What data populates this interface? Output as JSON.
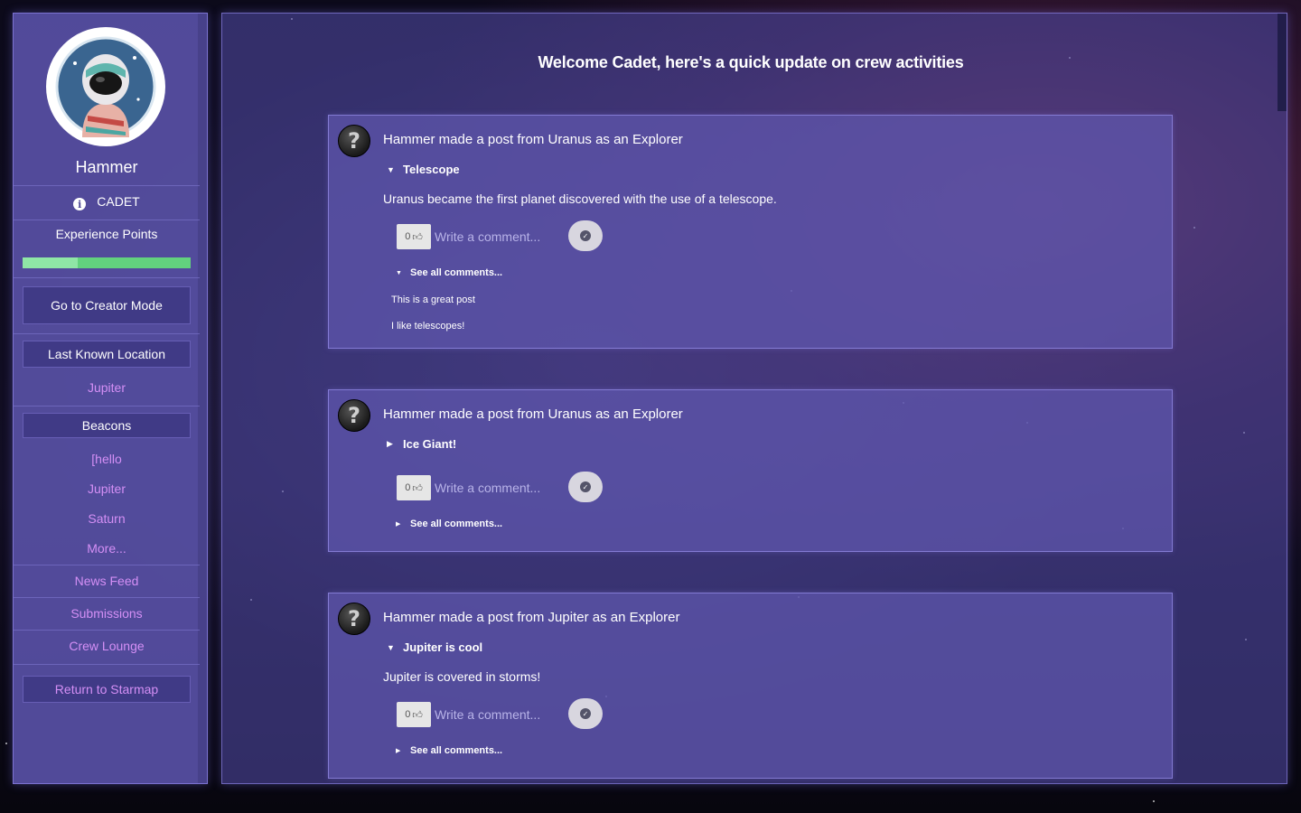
{
  "sidebar": {
    "username": "Hammer",
    "rank": "CADET",
    "xp_label": "Experience Points",
    "xp_progress": 0.33,
    "creator_mode_label": "Go to Creator Mode",
    "last_location_label": "Last Known Location",
    "last_location_value": "Jupiter",
    "beacons_label": "Beacons",
    "beacons": [
      "[hello",
      "Jupiter",
      "Saturn",
      "More..."
    ],
    "nav": [
      "News Feed",
      "Submissions",
      "Crew Lounge"
    ],
    "return_label": "Return to Starmap"
  },
  "main": {
    "welcome": "Welcome Cadet, here's a quick update on crew activities",
    "posts": [
      {
        "header": "Hammer made a post from Uranus as an Explorer",
        "title": "Telescope",
        "body": "Uranus became the first planet discovered with the use of a telescope.",
        "likes": "0",
        "comment_placeholder": "Write a comment...",
        "see_all": "See all comments...",
        "comments": [
          "This is a great post",
          "I like telescopes!"
        ]
      },
      {
        "header": "Hammer made a post from Uranus as an Explorer",
        "title": "Ice Giant!",
        "likes": "0",
        "comment_placeholder": "Write a comment...",
        "see_all": "See all comments..."
      },
      {
        "header": "Hammer made a post from Jupiter as an Explorer",
        "title": "Jupiter is cool",
        "body": "Jupiter is covered in storms!",
        "likes": "0",
        "comment_placeholder": "Write a comment...",
        "see_all": "See all comments..."
      }
    ]
  },
  "colors": {
    "sidebar_bg": "#5850a5",
    "button_bg": "#403a86",
    "link": "#d48ff5",
    "xp_bar": "#62d27e"
  }
}
